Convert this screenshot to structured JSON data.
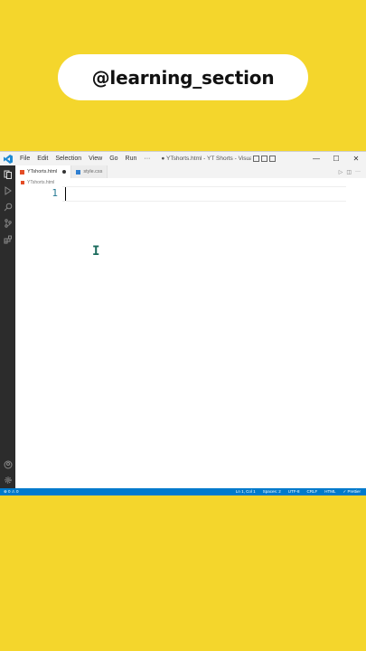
{
  "handle": "@learning_section",
  "titlebar": {
    "menu": [
      "File",
      "Edit",
      "Selection",
      "View",
      "Go",
      "Run",
      "···"
    ],
    "window_title": "● YTshorts.html - YT Shorts - Visual...",
    "controls": {
      "minimize": "—",
      "maximize": "☐",
      "close": "✕"
    }
  },
  "tabs": [
    {
      "label": "YTshorts.html",
      "modified": true,
      "lang": "html"
    },
    {
      "label": "style.css",
      "modified": false,
      "lang": "css"
    }
  ],
  "tab_actions": {
    "run": "▷",
    "split": "◫",
    "more": "···"
  },
  "breadcrumb": {
    "file": "YTshorts.html"
  },
  "editor": {
    "line_numbers": [
      "1"
    ],
    "ibeam_glyph": "I"
  },
  "statusbar": {
    "left": "⊗ 0 ⚠ 0",
    "right": [
      "Ln 1, Col 1",
      "Spaces: 2",
      "UTF-8",
      "CRLF",
      "HTML",
      "✓ Prettier"
    ]
  },
  "colors": {
    "background": "#f4d62c",
    "statusbar": "#007acc",
    "activitybar": "#2c2c2c"
  }
}
